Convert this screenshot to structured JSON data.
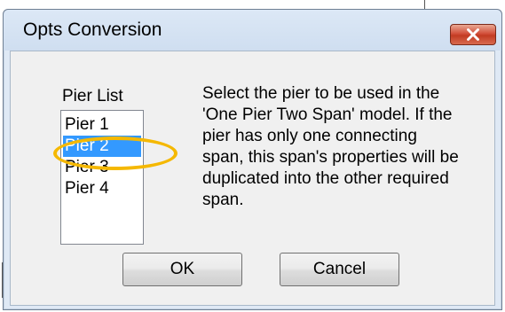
{
  "dialog": {
    "title": "Opts Conversion",
    "close_icon": "close-icon",
    "close_color": "#c23b22"
  },
  "pier_list": {
    "label": "Pier List",
    "items": [
      "Pier 1",
      "Pier 2",
      "Pier 3",
      "Pier 4"
    ],
    "selected": "Pier 2",
    "highlight_color": "#f5b800",
    "selection_color": "#3399ff"
  },
  "description": {
    "lines": [
      "Select the pier to be used in the",
      "'One Pier Two Span' model.  If the",
      "pier has only one connecting",
      "span, this span's properties will be",
      "duplicated into the other required",
      "span."
    ]
  },
  "buttons": {
    "ok_label": "OK",
    "cancel_label": "Cancel"
  }
}
